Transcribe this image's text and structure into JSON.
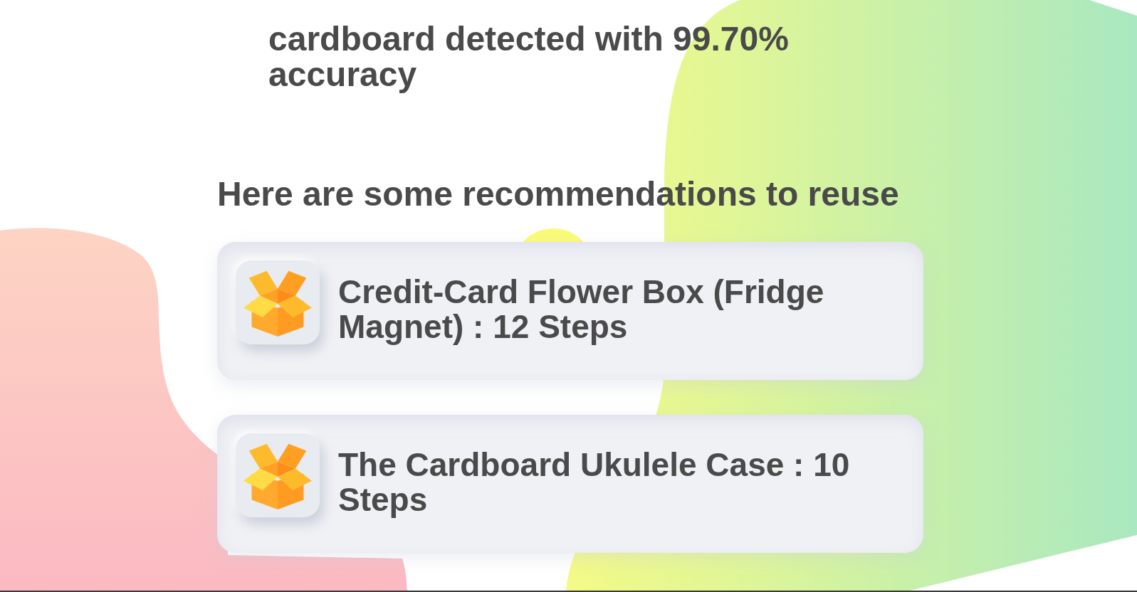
{
  "detection": {
    "text": "cardboard detected with 99.70% accuracy"
  },
  "recommendations": {
    "heading": "Here are some recommendations to reuse",
    "items": [
      {
        "title": "Credit-Card Flower Box (Fridge Magnet) : 12 Steps"
      },
      {
        "title": "The Cardboard Ukulele Case : 10 Steps"
      }
    ]
  }
}
